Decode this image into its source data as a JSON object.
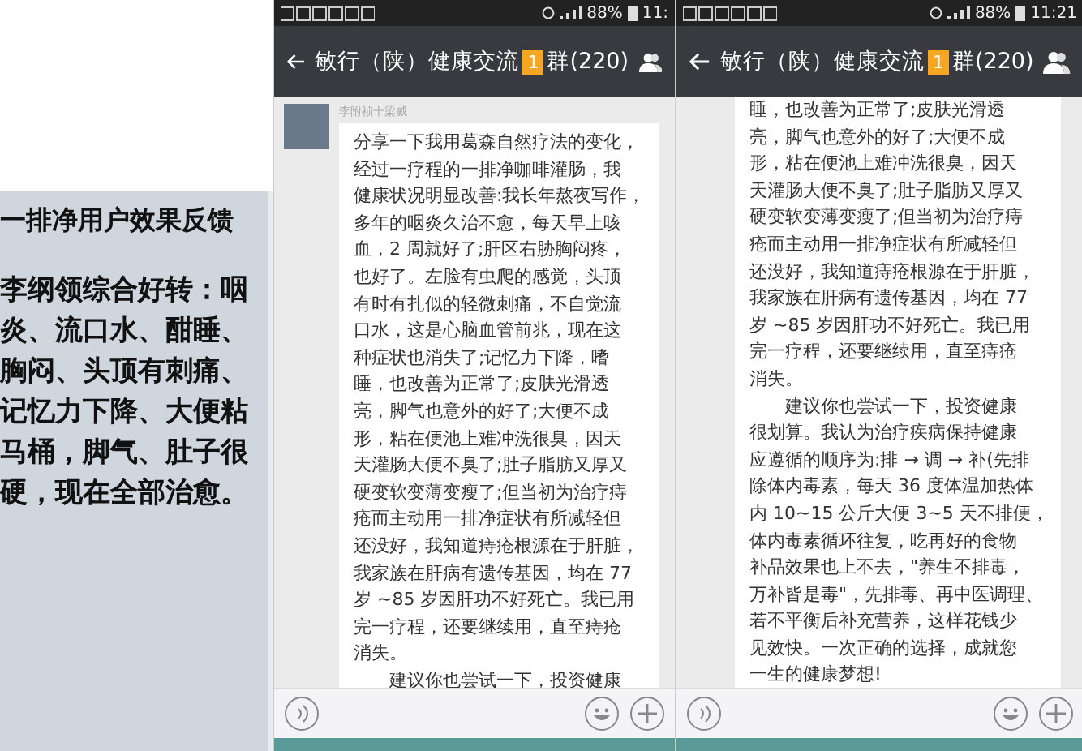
{
  "slide": {
    "title": "一排净用户效果反馈",
    "body": "李纲领综合好转：咽炎、流口水、酣睡、胸闷、头顶有刺痛、记忆力下降、大便粘马桶，脚气、肚子很硬，现在全部治愈。"
  },
  "phones": [
    {
      "status": {
        "battery": "88%",
        "time": "11:"
      },
      "header": {
        "title": "敏行（陕）健康交流",
        "badge": "1",
        "suffix": "群(220)"
      },
      "message": {
        "kind": "with_avatar",
        "sender": "李附祯十梁威",
        "lines": [
          "分享一下我用葛森自然疗法的变化，",
          "经过一疗程的一排净咖啡灌肠，我",
          "健康状况明显改善:我长年熬夜写作，",
          "多年的咽炎久治不愈，每天早上咳",
          "血，2 周就好了;肝区右胁胸闷疼，",
          "也好了。左脸有虫爬的感觉，头顶",
          "有时有扎似的轻微刺痛，不自觉流",
          "口水，这是心脑血管前兆，现在这",
          "种症状也消失了;记忆力下降，嗜",
          "睡，也改善为正常了;皮肤光滑透",
          "亮，脚气也意外的好了;大便不成",
          "形，粘在便池上难冲洗很臭，因天",
          "天灌肠大便不臭了;肚子脂肪又厚又",
          "硬变软变薄变瘦了;但当初为治疗痔",
          "疮而主动用一排净症状有所减轻但",
          "还没好，我知道痔疮根源在于肝脏，",
          "我家族在肝病有遗传基因，均在 77",
          "岁 ~85 岁因肝功不好死亡。我已用",
          "完一疗程，还要继续用，直至痔疮",
          "消失。",
          "　　建议你也尝试一下，投资健康"
        ]
      }
    },
    {
      "status": {
        "battery": "88%",
        "time": "11:21"
      },
      "header": {
        "title": "敏行（陕）健康交流",
        "badge": "1",
        "suffix": "群(220)"
      },
      "message": {
        "kind": "continued",
        "lines": [
          "睡，也改善为正常了;皮肤光滑透",
          "亮，脚气也意外的好了;大便不成",
          "形，粘在便池上难冲洗很臭，因天",
          "天灌肠大便不臭了;肚子脂肪又厚又",
          "硬变软变薄变瘦了;但当初为治疗痔",
          "疮而主动用一排净症状有所减轻但",
          "还没好，我知道痔疮根源在于肝脏，",
          "我家族在肝病有遗传基因，均在 77",
          "岁 ~85 岁因肝功不好死亡。我已用",
          "完一疗程，还要继续用，直至痔疮",
          "消失。",
          "　　建议你也尝试一下，投资健康",
          "很划算。我认为治疗疾病保持健康",
          "应遵循的顺序为:排 → 调 → 补(先排",
          "除体内毒素，每天 36 度体温加热体",
          "内 10~15 公斤大便 3~5 天不排便，",
          "体内毒素循环往复，吃再好的食物",
          "补品效果也上不去，\"养生不排毒，",
          "万补皆是毒\"，先排毒、再中医调理、",
          "若不平衡后补充营养，这样花钱少",
          "见效快。一次正确的选择，成就您",
          "一生的健康梦想!"
        ]
      }
    }
  ]
}
